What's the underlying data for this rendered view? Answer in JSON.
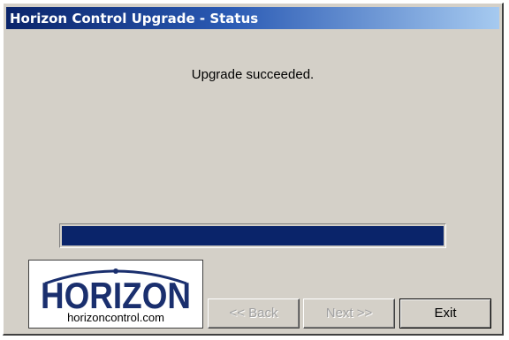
{
  "window": {
    "title": "Horizon Control Upgrade - Status"
  },
  "status": {
    "message": "Upgrade succeeded.",
    "progress_fraction": 1.0,
    "progress_color": "#0a246a"
  },
  "logo": {
    "wordmark": "HORIZON",
    "url": "horizoncontrol.com",
    "color": "#1a2f6e"
  },
  "buttons": {
    "back_label": "<< Back",
    "next_label": "Next >>",
    "exit_label": "Exit"
  }
}
